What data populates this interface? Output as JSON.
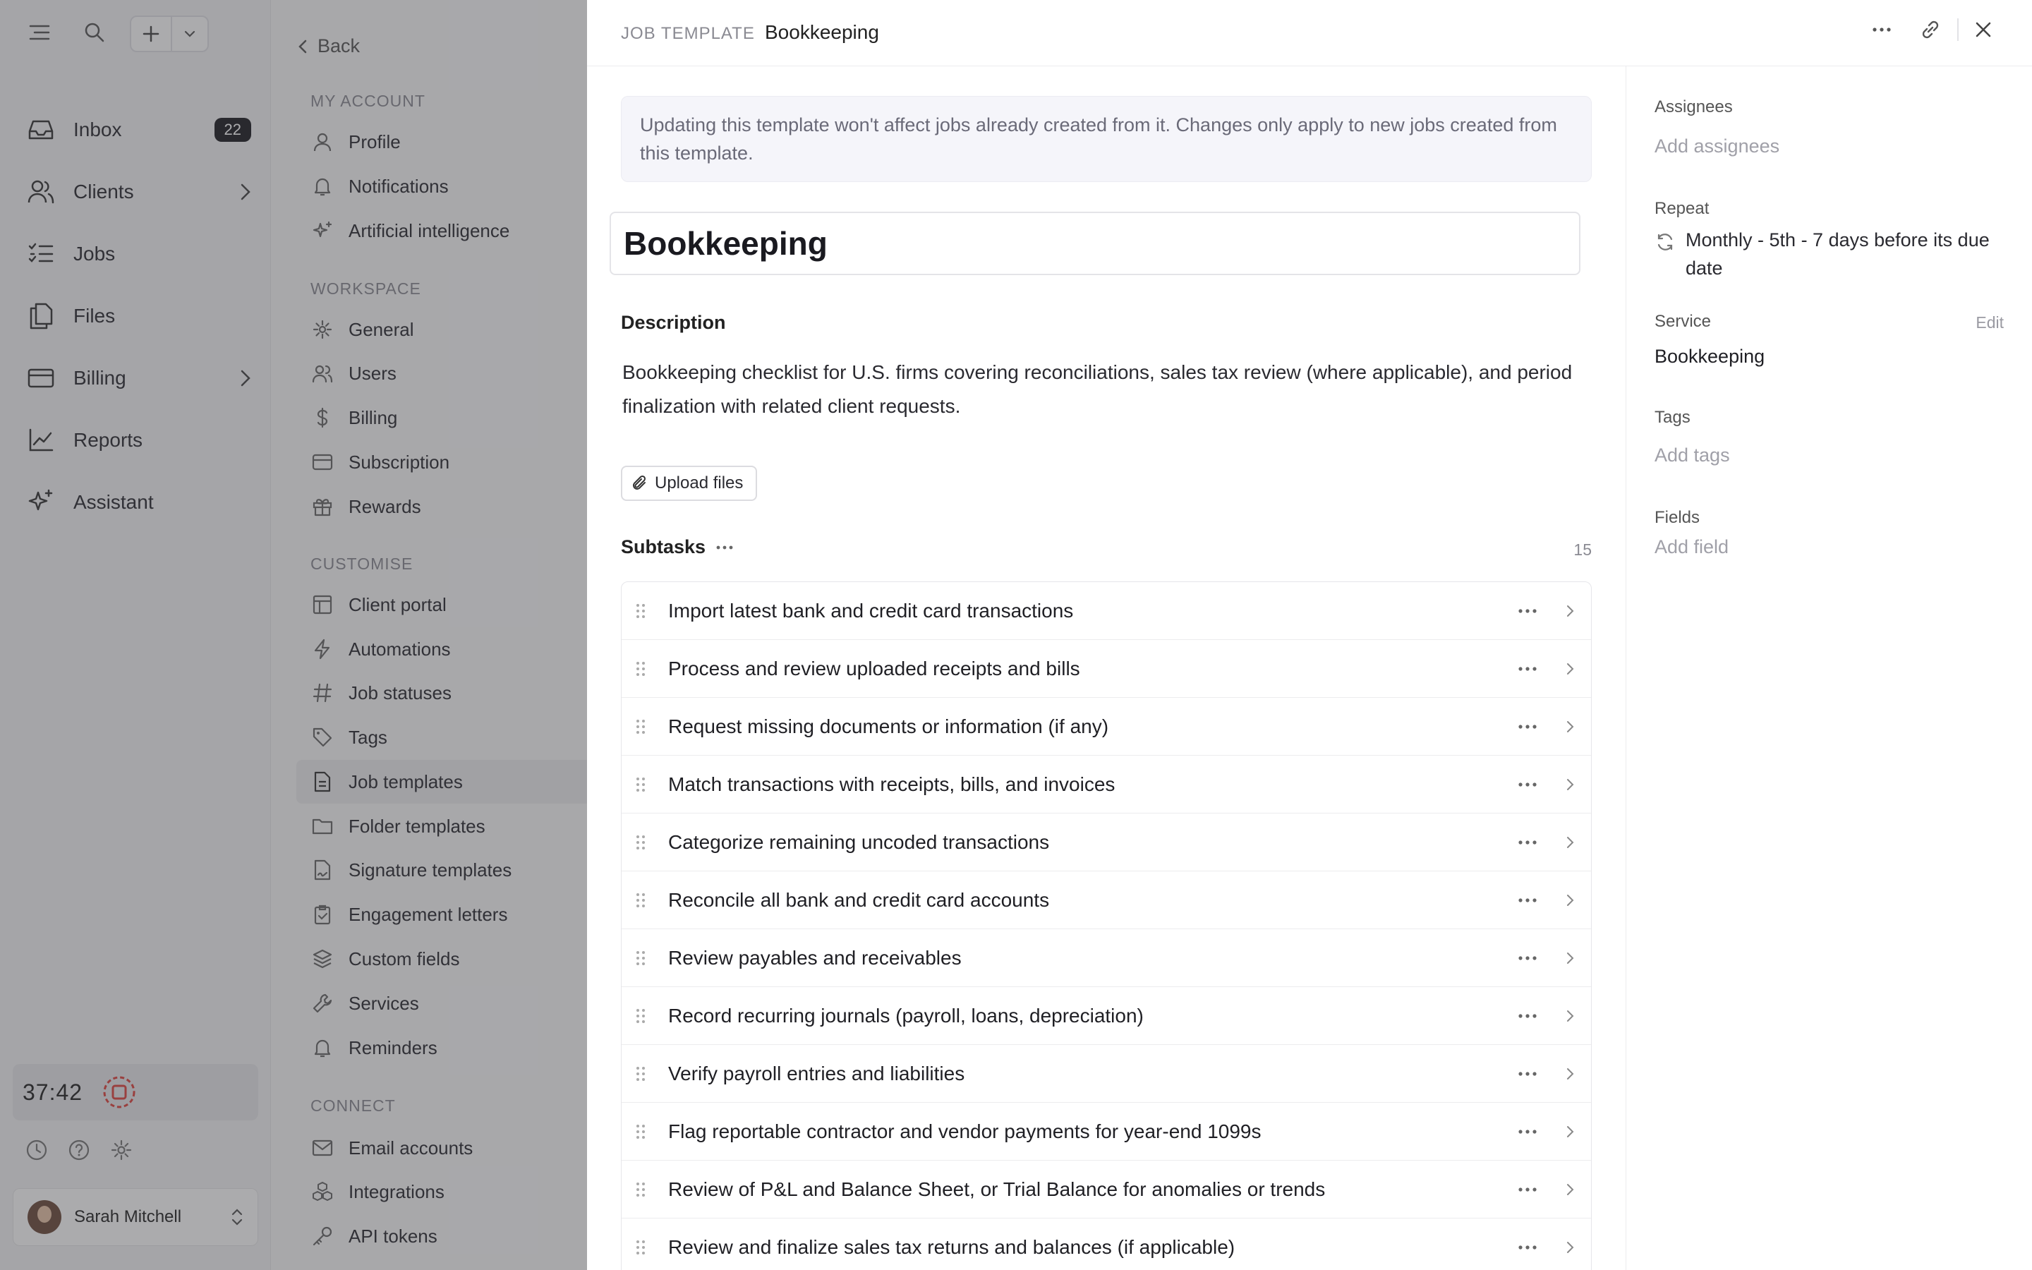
{
  "leftnav": {
    "new_button_icon": "plus-icon",
    "items": [
      {
        "label": "Inbox",
        "icon": "inbox-icon",
        "badge": "22"
      },
      {
        "label": "Clients",
        "icon": "users-icon"
      },
      {
        "label": "Jobs",
        "icon": "list-check-icon"
      },
      {
        "label": "Files",
        "icon": "files-icon"
      },
      {
        "label": "Billing",
        "icon": "card-icon"
      },
      {
        "label": "Reports",
        "icon": "chart-icon"
      },
      {
        "label": "Assistant",
        "icon": "sparkle-icon"
      }
    ],
    "timer": "37:42",
    "user_name": "Sarah Mitchell"
  },
  "settings": {
    "back_label": "Back",
    "sections": {
      "my_account": "MY ACCOUNT",
      "workspace": "WORKSPACE",
      "customise": "CUSTOMISE",
      "connect": "CONNECT"
    },
    "my_account": [
      "Profile",
      "Notifications",
      "Artificial intelligence"
    ],
    "workspace": [
      "General",
      "Users",
      "Billing",
      "Subscription",
      "Rewards"
    ],
    "customise": [
      "Client portal",
      "Automations",
      "Job statuses",
      "Tags",
      "Job templates",
      "Folder templates",
      "Signature templates",
      "Engagement letters",
      "Custom fields",
      "Services",
      "Reminders"
    ],
    "connect": [
      "Email accounts",
      "Integrations",
      "API tokens"
    ],
    "active": "Job templates"
  },
  "drawer": {
    "type_label": "JOB TEMPLATE",
    "title": "Bookkeeping",
    "notice": "Updating this template won't affect jobs already created from it. Changes only apply to new jobs created from this template.",
    "name_value": "Bookkeeping",
    "description_heading": "Description",
    "description": "Bookkeeping checklist for U.S. firms covering reconciliations, sales tax review (where applicable), and period finalization with related client requests.",
    "upload_label": "Upload files",
    "subtasks_heading": "Subtasks",
    "subtasks_count": "15",
    "subtasks": [
      "Import latest bank and credit card transactions",
      "Process and review uploaded receipts and bills",
      "Request missing documents or information (if any)",
      "Match transactions with receipts, bills, and invoices",
      "Categorize remaining uncoded transactions",
      "Reconcile all bank and credit card accounts",
      "Review payables and receivables",
      "Record recurring journals (payroll, loans, depreciation)",
      "Verify payroll entries and liabilities",
      "Flag reportable contractor and vendor payments for year-end 1099s",
      "Review of P&L and Balance Sheet, or Trial Balance for anomalies or trends",
      "Review and finalize sales tax returns and balances (if applicable)"
    ]
  },
  "panel": {
    "assignees_label": "Assignees",
    "assignees_placeholder": "Add assignees",
    "repeat_label": "Repeat",
    "repeat_value": "Monthly - 5th - 7 days before its due date",
    "service_label": "Service",
    "service_edit": "Edit",
    "service_value": "Bookkeeping",
    "tags_label": "Tags",
    "tags_placeholder": "Add tags",
    "fields_label": "Fields",
    "fields_placeholder": "Add field"
  }
}
